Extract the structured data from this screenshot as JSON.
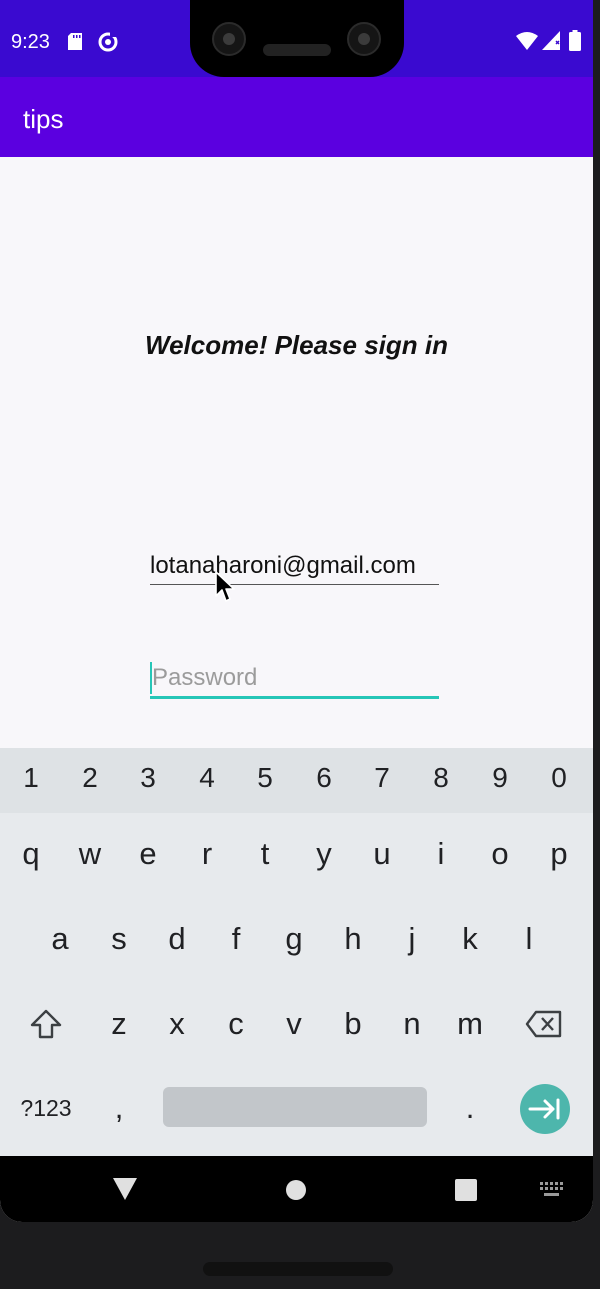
{
  "status_bar": {
    "time": "9:23",
    "background_color": "#3a0ad0",
    "icons": [
      "sd-card-icon",
      "sync-icon",
      "wifi-icon",
      "signal-icon",
      "battery-icon"
    ]
  },
  "app_bar": {
    "title": "tips",
    "background_color": "#5b00e0"
  },
  "main": {
    "welcome_text": "Welcome! Please sign in",
    "email_value": "lotanaharoni@gmail.com",
    "password_placeholder": "Password",
    "password_value": "",
    "accent_color": "#26c6b7"
  },
  "keyboard": {
    "number_row": [
      "1",
      "2",
      "3",
      "4",
      "5",
      "6",
      "7",
      "8",
      "9",
      "0"
    ],
    "row1": [
      "q",
      "w",
      "e",
      "r",
      "t",
      "y",
      "u",
      "i",
      "o",
      "p"
    ],
    "row2": [
      "a",
      "s",
      "d",
      "f",
      "g",
      "h",
      "j",
      "k",
      "l"
    ],
    "row3": [
      "z",
      "x",
      "c",
      "v",
      "b",
      "n",
      "m"
    ],
    "symbols_key": "?123",
    "comma_key": ",",
    "period_key": ".",
    "shift_icon": "shift-icon",
    "backspace_icon": "backspace-icon",
    "enter_icon": "next-arrow-icon",
    "enter_color": "#4db6ac"
  },
  "nav_bar": {
    "icons": [
      "back-icon",
      "home-icon",
      "recents-icon",
      "keyboard-switch-icon"
    ]
  }
}
